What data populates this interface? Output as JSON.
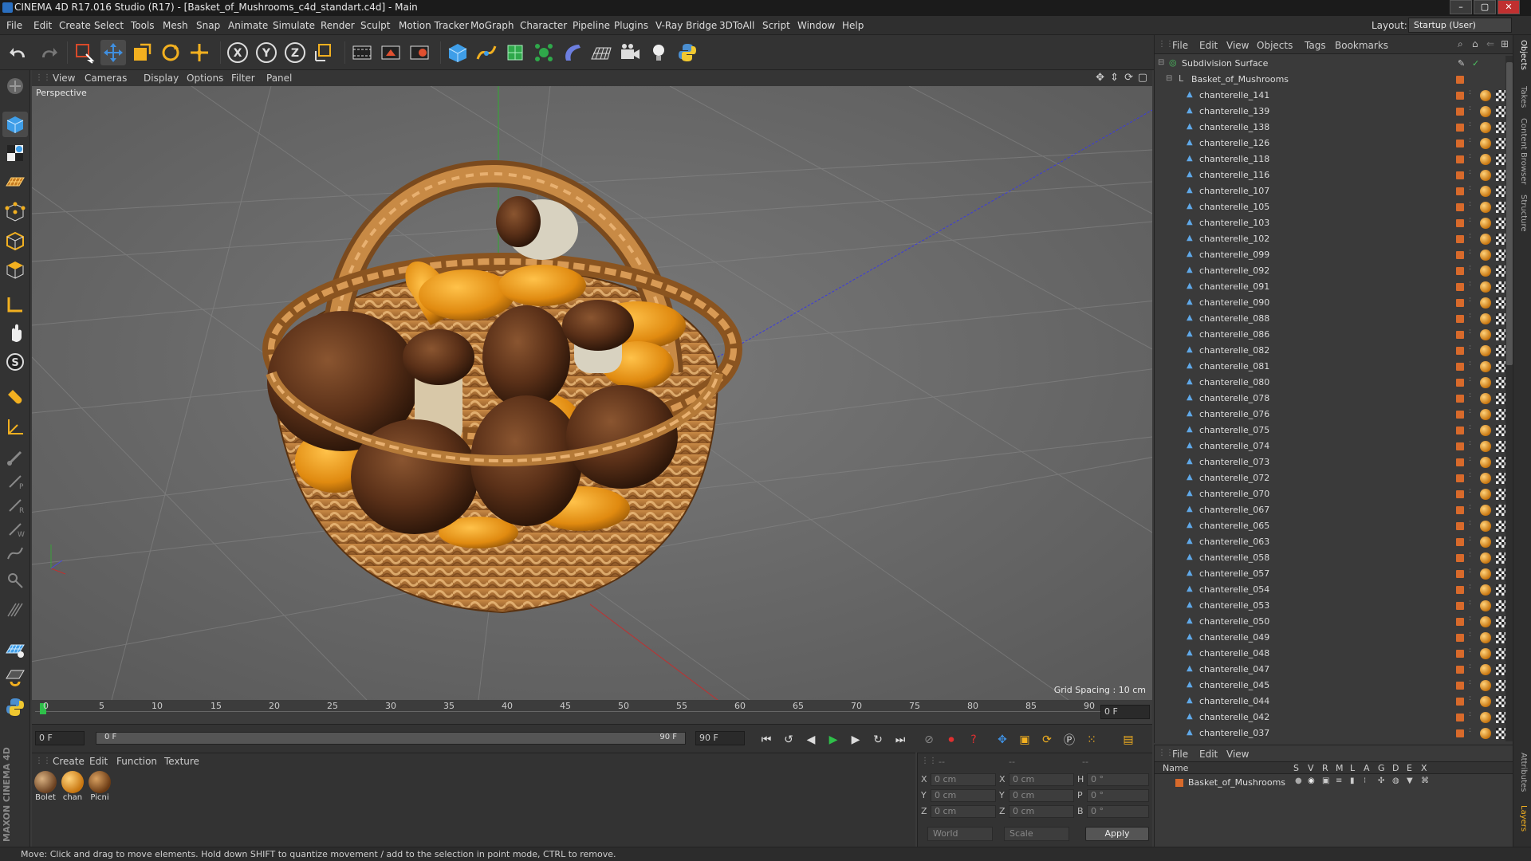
{
  "window": {
    "title": "CINEMA 4D R17.016 Studio (R17) - [Basket_of_Mushrooms_c4d_standart.c4d] - Main",
    "buttons": [
      "–",
      "▢",
      "✕"
    ]
  },
  "menubar": {
    "items": [
      "File",
      "Edit",
      "Create",
      "Select",
      "Tools",
      "Mesh",
      "Snap",
      "Animate",
      "Simulate",
      "Render",
      "Sculpt",
      "Motion Tracker",
      "MoGraph",
      "Character",
      "Pipeline",
      "Plugins",
      "V-Ray Bridge",
      "3DToAll",
      "Script",
      "Window",
      "Help"
    ],
    "layout_label": "Layout:",
    "layout_value": "Startup (User)"
  },
  "viewport": {
    "menu": [
      "View",
      "Cameras",
      "Display",
      "Options",
      "Filter",
      "Panel"
    ],
    "camera_label": "Perspective",
    "grid_spacing": "Grid Spacing : 10 cm"
  },
  "timeline": {
    "ticks": [
      "0",
      "5",
      "10",
      "15",
      "20",
      "25",
      "30",
      "35",
      "40",
      "45",
      "50",
      "55",
      "60",
      "65",
      "70",
      "75",
      "80",
      "85",
      "90"
    ],
    "end_field": "0 F"
  },
  "playbar": {
    "current_frame": "0 F",
    "range_start": "0 F",
    "range_end": "90 F",
    "max_frame": "90 F"
  },
  "materials": {
    "menu": [
      "Create",
      "Edit",
      "Function",
      "Texture"
    ],
    "items": [
      {
        "label": "Bolet",
        "color": "#8a5a2a"
      },
      {
        "label": "chan",
        "color": "#e09a1a"
      },
      {
        "label": "Picni",
        "color": "#a06a35"
      }
    ]
  },
  "coordinates": {
    "headers": [
      "--",
      "--",
      "--"
    ],
    "rows": [
      {
        "a": "X",
        "v1": "0 cm",
        "b": "X",
        "v2": "0 cm",
        "c": "H",
        "v3": "0 °"
      },
      {
        "a": "Y",
        "v1": "0 cm",
        "b": "Y",
        "v2": "0 cm",
        "c": "P",
        "v3": "0 °"
      },
      {
        "a": "Z",
        "v1": "0 cm",
        "b": "Z",
        "v2": "0 cm",
        "c": "B",
        "v3": "0 °"
      }
    ],
    "mode": "World",
    "type": "Scale",
    "apply": "Apply"
  },
  "objects": {
    "menu": [
      "File",
      "Edit",
      "View",
      "Objects",
      "Tags",
      "Bookmarks"
    ],
    "root": "Subdivision Surface",
    "group": "Basket_of_Mushrooms",
    "items": [
      "chanterelle_141",
      "chanterelle_139",
      "chanterelle_138",
      "chanterelle_126",
      "chanterelle_118",
      "chanterelle_116",
      "chanterelle_107",
      "chanterelle_105",
      "chanterelle_103",
      "chanterelle_102",
      "chanterelle_099",
      "chanterelle_092",
      "chanterelle_091",
      "chanterelle_090",
      "chanterelle_088",
      "chanterelle_086",
      "chanterelle_082",
      "chanterelle_081",
      "chanterelle_080",
      "chanterelle_078",
      "chanterelle_076",
      "chanterelle_075",
      "chanterelle_074",
      "chanterelle_073",
      "chanterelle_072",
      "chanterelle_070",
      "chanterelle_067",
      "chanterelle_065",
      "chanterelle_063",
      "chanterelle_058",
      "chanterelle_057",
      "chanterelle_054",
      "chanterelle_053",
      "chanterelle_050",
      "chanterelle_049",
      "chanterelle_048",
      "chanterelle_047",
      "chanterelle_045",
      "chanterelle_044",
      "chanterelle_042",
      "chanterelle_037"
    ]
  },
  "layers": {
    "menu": [
      "File",
      "Edit",
      "View"
    ],
    "name_header": "Name",
    "col_headers": [
      "S",
      "V",
      "R",
      "M",
      "L",
      "A",
      "G",
      "D",
      "E",
      "X"
    ],
    "row": "Basket_of_Mushrooms"
  },
  "right_tabs": [
    "Objects",
    "Takes",
    "Content Browser",
    "Structure",
    "Attributes",
    "Layers"
  ],
  "brand": "MAXON CINEMA 4D",
  "status": "Move: Click and drag to move elements. Hold down SHIFT to quantize movement / add to the selection in point mode, CTRL to remove."
}
